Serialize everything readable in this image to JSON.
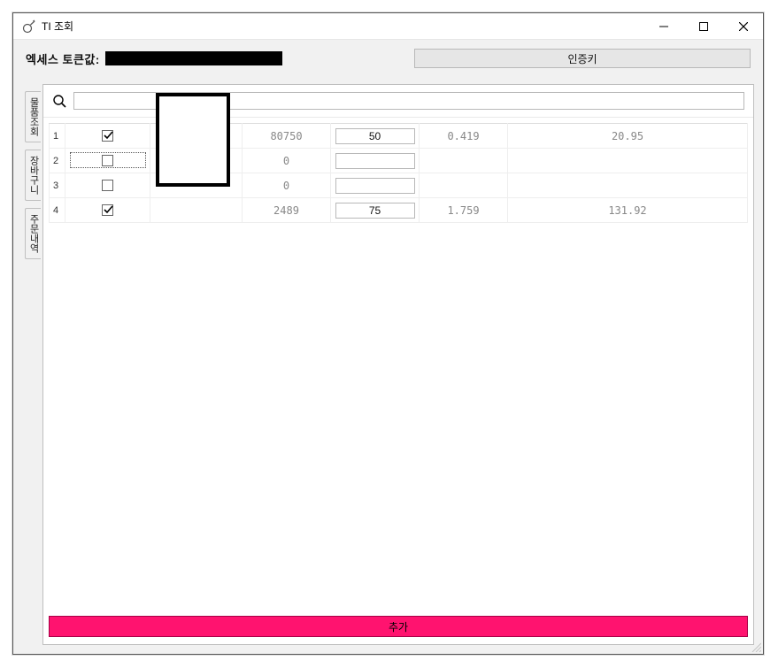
{
  "window": {
    "title": "TI 조회"
  },
  "top": {
    "token_label": "엑세스 토큰값:",
    "auth_button": "인증키"
  },
  "tabs": [
    {
      "label": "물품조회",
      "active": false
    },
    {
      "label": "장바구니",
      "active": false
    },
    {
      "label": "주문내역",
      "active": false
    }
  ],
  "search": {
    "placeholder": ""
  },
  "rows": [
    {
      "idx": "1",
      "checked": true,
      "focus": false,
      "c1": "80750",
      "c2": "50",
      "c3": "0.419",
      "c4": "20.95"
    },
    {
      "idx": "2",
      "checked": false,
      "focus": true,
      "c1": "0",
      "c2": "",
      "c3": "",
      "c4": ""
    },
    {
      "idx": "3",
      "checked": false,
      "focus": false,
      "c1": "0",
      "c2": "",
      "c3": "",
      "c4": ""
    },
    {
      "idx": "4",
      "checked": true,
      "focus": false,
      "c1": "2489",
      "c2": "75",
      "c3": "1.759",
      "c4": "131.92"
    }
  ],
  "bottom": {
    "add_button": "추가"
  }
}
